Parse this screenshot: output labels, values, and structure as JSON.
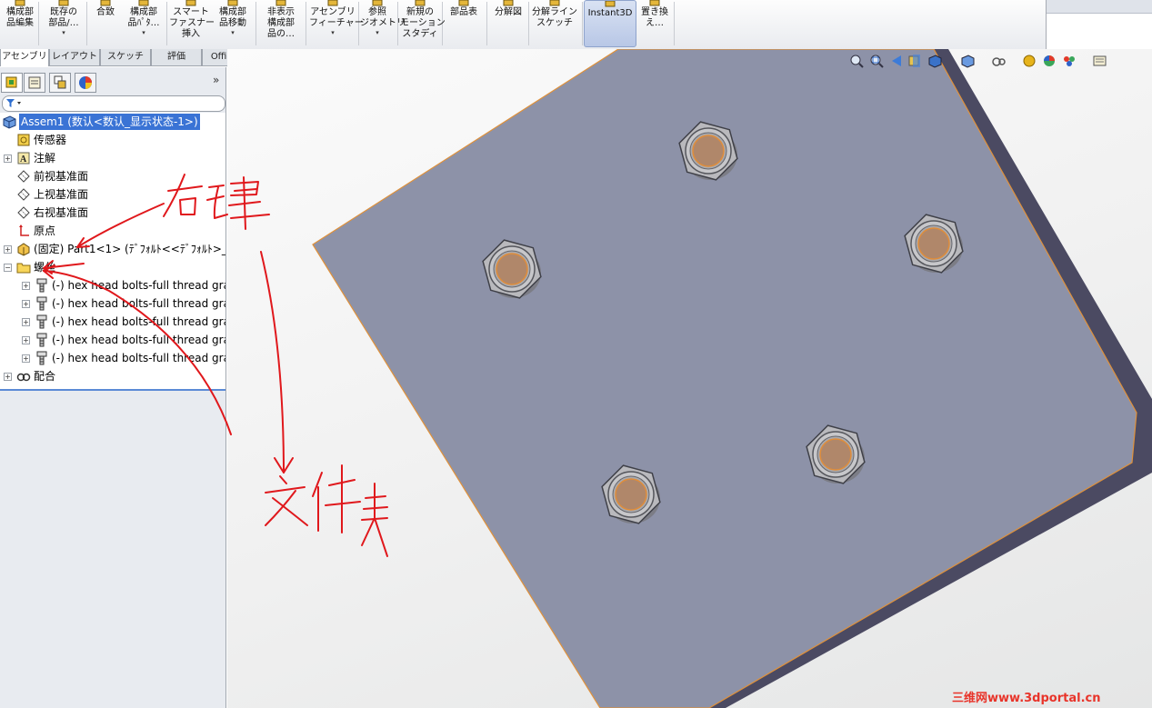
{
  "ribbon": {
    "buttons": [
      {
        "label": "構成部\n品編集",
        "dropdown": false,
        "icon": "edit-component-icon"
      },
      {
        "label": "既存の\n部品/…",
        "dropdown": true,
        "icon": "insert-component-icon"
      },
      {
        "label": "合致",
        "dropdown": false,
        "icon": "mate-icon"
      },
      {
        "label": "構成部\n品ﾊﾟﾀ…",
        "dropdown": true,
        "icon": "component-pattern-icon"
      },
      {
        "label": "スマート\nファスナー\n挿入",
        "dropdown": false,
        "icon": "smart-fastener-icon"
      },
      {
        "label": "構成部\n品移動",
        "dropdown": true,
        "icon": "move-component-icon"
      },
      {
        "label": "非表示\n構成部\n品の…",
        "dropdown": false,
        "icon": "hide-components-icon"
      },
      {
        "label": "アセンブリ\nフィーチャー",
        "dropdown": true,
        "icon": "assembly-feature-icon"
      },
      {
        "label": "参照\nジオメトリ",
        "dropdown": true,
        "icon": "reference-geometry-icon"
      },
      {
        "label": "新規の\nモーション\nスタディ",
        "dropdown": false,
        "icon": "motion-study-icon"
      },
      {
        "label": "部品表",
        "dropdown": false,
        "icon": "bom-icon"
      },
      {
        "label": "分解図",
        "dropdown": false,
        "icon": "exploded-view-icon"
      },
      {
        "label": "分解ライン\nスケッチ",
        "dropdown": false,
        "icon": "explode-line-sketch-icon"
      },
      {
        "label": "Instant3D",
        "dropdown": false,
        "icon": "instant3d-icon",
        "active": true
      },
      {
        "label": "置き換\nえ…",
        "dropdown": false,
        "icon": "replace-component-icon"
      }
    ]
  },
  "command_tabs": [
    "アセンブリ",
    "レイアウト",
    "スケッチ",
    "評価",
    "Office 製品"
  ],
  "tree": {
    "items": [
      {
        "label": "Assem1  (数认<数认_显示状态-1>)",
        "icon": "assembly-icon",
        "expander": "",
        "selected": true
      },
      {
        "label": "传感器",
        "icon": "sensor-icon",
        "expander": ""
      },
      {
        "label": "注解",
        "icon": "annotation-icon",
        "expander": "+"
      },
      {
        "label": "前视基准面",
        "icon": "plane-icon",
        "expander": ""
      },
      {
        "label": "上视基准面",
        "icon": "plane-icon",
        "expander": ""
      },
      {
        "label": "右视基准面",
        "icon": "plane-icon",
        "expander": ""
      },
      {
        "label": "原点",
        "icon": "origin-icon",
        "expander": ""
      },
      {
        "label": "(固定) Part1<1> (ﾃﾞﾌｫﾙﾄ<<ﾃﾞﾌｫﾙﾄ>_",
        "icon": "part-icon",
        "expander": "+"
      },
      {
        "label": "螺丝",
        "icon": "folder-icon",
        "expander": "−"
      },
      {
        "label": "(-) hex head bolts-full thread gra",
        "icon": "bolt-icon",
        "expander": "+"
      },
      {
        "label": "(-) hex head bolts-full thread gra",
        "icon": "bolt-icon",
        "expander": "+"
      },
      {
        "label": "(-) hex head bolts-full thread gra",
        "icon": "bolt-icon",
        "expander": "+"
      },
      {
        "label": "(-) hex head bolts-full thread gra",
        "icon": "bolt-icon",
        "expander": "+"
      },
      {
        "label": "(-) hex head bolts-full thread gra",
        "icon": "bolt-icon",
        "expander": "+"
      },
      {
        "label": "配合",
        "icon": "mates-icon",
        "expander": "+"
      }
    ]
  },
  "annotations": {
    "right_click": "右键",
    "folder": "文件夹"
  },
  "watermark": "三维网www.3dportal.cn",
  "colors": {
    "plate_face": "#8d92a8",
    "plate_edge": "#4b4a62",
    "bolt_core": "#b0876a",
    "selection": "#3a73d5",
    "annotation": "#e0181c"
  }
}
